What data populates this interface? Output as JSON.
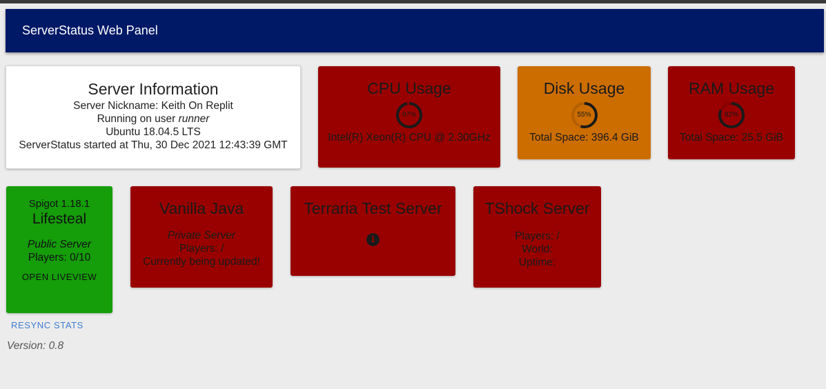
{
  "appbar": {
    "title": "ServerStatus Web Panel"
  },
  "info": {
    "title": "Server Information",
    "nickname_line": "Server Nickname: Keith On Replit",
    "running_prefix": "Running on user ",
    "running_user": "runner",
    "os": "Ubuntu 18.04.5 LTS",
    "started": "ServerStatus started at Thu, 30 Dec 2021 12:43:39 GMT"
  },
  "cpu": {
    "title": "CPU Usage",
    "percent_label": "97%",
    "percent": 97,
    "detail": "Intel(R) Xeon(R) CPU @ 2.30GHz",
    "color": "#990000"
  },
  "disk": {
    "title": "Disk Usage",
    "percent_label": "55%",
    "percent": 55,
    "detail": "Total Space: 396.4 GiB",
    "color": "#cc6d00"
  },
  "ram": {
    "title": "RAM Usage",
    "percent_label": "82%",
    "percent": 82,
    "detail": "Total Space: 25.5 GiB",
    "color": "#990000"
  },
  "servers": {
    "lifesteal": {
      "version": "Spigot 1.18.1",
      "name": "Lifesteal",
      "visibility": "Public Server",
      "players": "Players: 0/10",
      "liveview_label": "OPEN LIVEVIEW",
      "color": "#159d0a"
    },
    "vanilla": {
      "name": "Vanilla Java",
      "visibility": "Private Server",
      "players": "Players: /",
      "status": "Currently being updated!",
      "color": "#990000"
    },
    "terraria": {
      "name": "Terraria Test Server",
      "icon": "info-icon",
      "icon_glyph": "i",
      "color": "#990000"
    },
    "tshock": {
      "name": "TShock Server",
      "players": "Players: /",
      "world": "World:",
      "uptime": "Uptime:",
      "color": "#990000"
    }
  },
  "footer": {
    "resync_label": "RESYNC STATS",
    "version": "Version: 0.8"
  }
}
